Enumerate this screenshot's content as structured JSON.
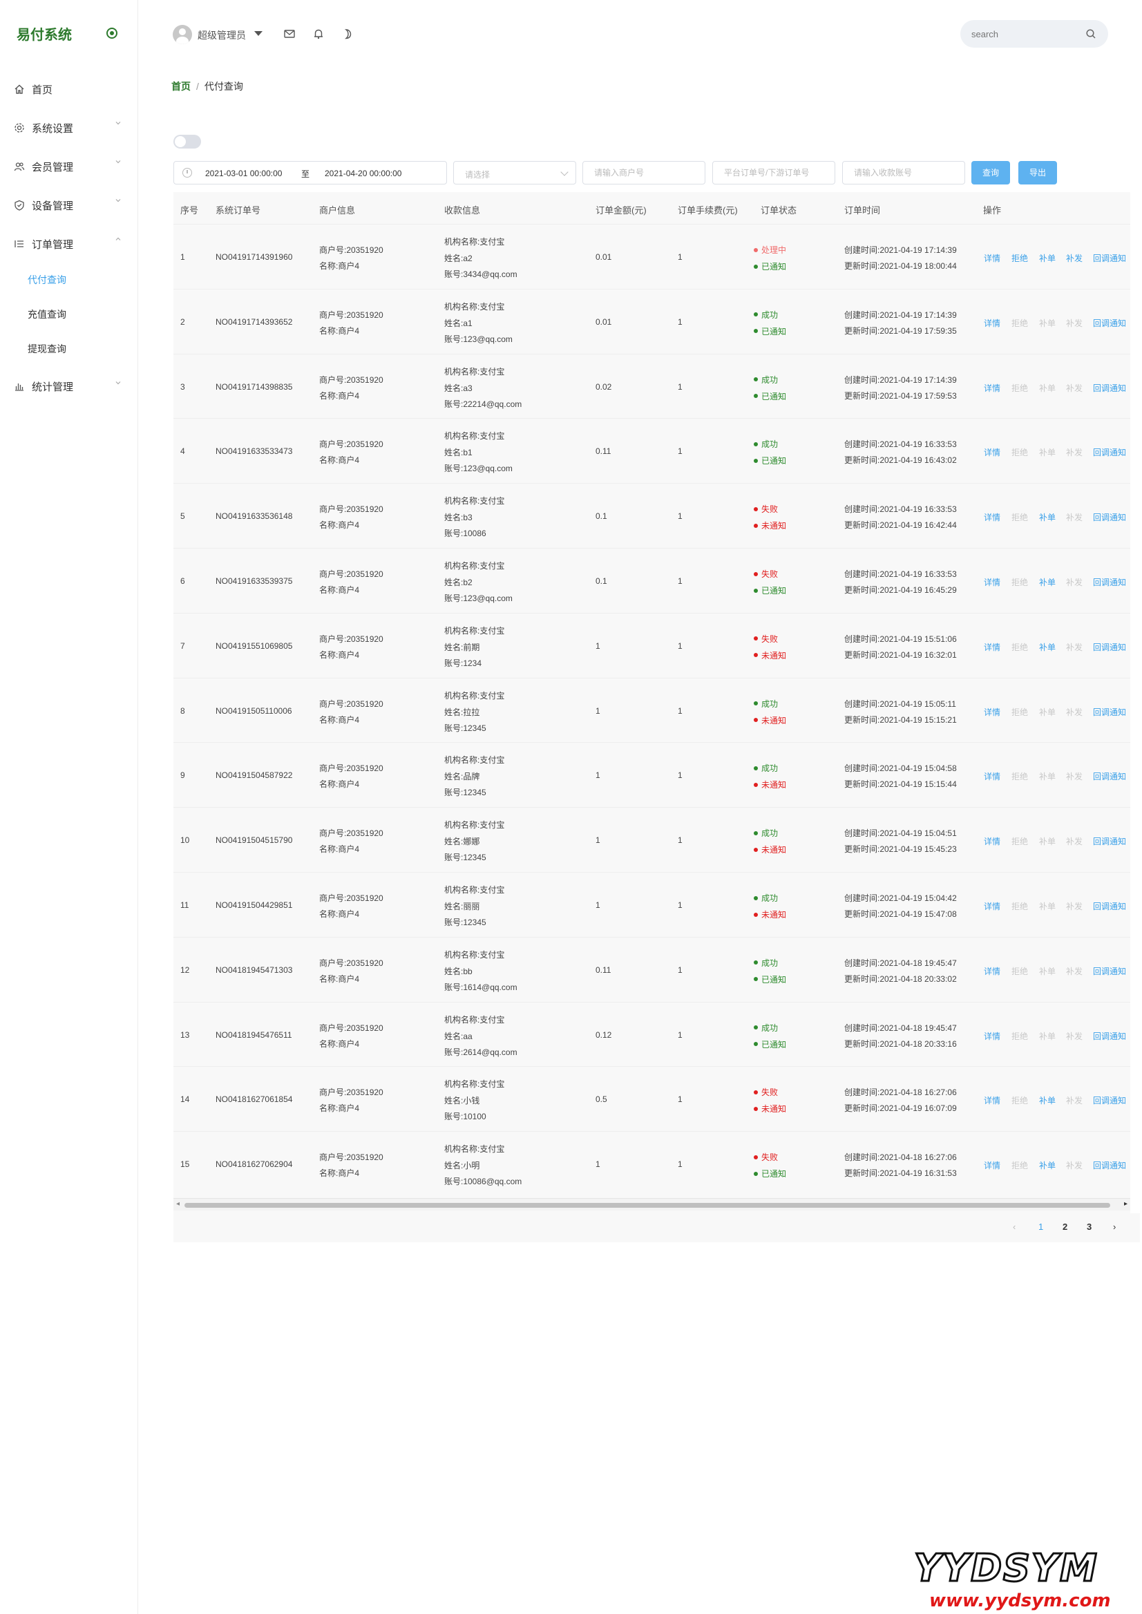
{
  "app": {
    "title": "易付系统"
  },
  "sidebar": {
    "items": [
      {
        "label": "首页",
        "icon": "home-icon"
      },
      {
        "label": "系统设置",
        "icon": "gear-icon"
      },
      {
        "label": "会员管理",
        "icon": "users-icon"
      },
      {
        "label": "设备管理",
        "icon": "shield-icon"
      },
      {
        "label": "订单管理",
        "icon": "list-icon"
      },
      {
        "label": "统计管理",
        "icon": "bar-chart-icon"
      }
    ],
    "sub_items": [
      {
        "label": "代付查询",
        "active": true
      },
      {
        "label": "充值查询",
        "active": false
      },
      {
        "label": "提现查询",
        "active": false
      }
    ]
  },
  "header": {
    "username": "超级管理员",
    "search_placeholder": "search"
  },
  "breadcrumb": {
    "home": "首页",
    "separator": "/",
    "current": "代付查询"
  },
  "filters": {
    "date_start": "2021-03-01 00:00:00",
    "date_sep": "至",
    "date_end": "2021-04-20 00:00:00",
    "select_placeholder": "请选择",
    "merchant_placeholder": "请输入商户号",
    "order_placeholder": "平台订单号/下游订单号",
    "account_placeholder": "请输入收款账号",
    "query_label": "查询",
    "export_label": "导出"
  },
  "table": {
    "headers": [
      "序号",
      "系统订单号",
      "商户信息",
      "收款信息",
      "订单金额(元)",
      "订单手续费(元)",
      "订单状态",
      "订单时间",
      "操作"
    ],
    "actions": [
      "详情",
      "拒绝",
      "补单",
      "补发",
      "回调通知"
    ],
    "rows": [
      {
        "idx": "1",
        "order_no": "NO04191714391960",
        "merchant_no": "商户号:20351920",
        "merchant_name": "名称:商户4",
        "org": "机构名称:支付宝",
        "name": "姓名:a2",
        "account": "账号:3434@qq.com",
        "amount": "0.01",
        "fee": "1",
        "status": "处理中",
        "status_color": "orange",
        "notify": "已通知",
        "notify_color": "green",
        "created": "创建时间:2021-04-19 17:14:39",
        "updated": "更新时间:2021-04-19 18:00:44",
        "enabled": [
          true,
          true,
          true,
          true,
          true
        ]
      },
      {
        "idx": "2",
        "order_no": "NO04191714393652",
        "merchant_no": "商户号:20351920",
        "merchant_name": "名称:商户4",
        "org": "机构名称:支付宝",
        "name": "姓名:a1",
        "account": "账号:123@qq.com",
        "amount": "0.01",
        "fee": "1",
        "status": "成功",
        "status_color": "green",
        "notify": "已通知",
        "notify_color": "green",
        "created": "创建时间:2021-04-19 17:14:39",
        "updated": "更新时间:2021-04-19 17:59:35",
        "enabled": [
          true,
          false,
          false,
          false,
          true
        ]
      },
      {
        "idx": "3",
        "order_no": "NO04191714398835",
        "merchant_no": "商户号:20351920",
        "merchant_name": "名称:商户4",
        "org": "机构名称:支付宝",
        "name": "姓名:a3",
        "account": "账号:22214@qq.com",
        "amount": "0.02",
        "fee": "1",
        "status": "成功",
        "status_color": "green",
        "notify": "已通知",
        "notify_color": "green",
        "created": "创建时间:2021-04-19 17:14:39",
        "updated": "更新时间:2021-04-19 17:59:53",
        "enabled": [
          true,
          false,
          false,
          false,
          true
        ]
      },
      {
        "idx": "4",
        "order_no": "NO04191633533473",
        "merchant_no": "商户号:20351920",
        "merchant_name": "名称:商户4",
        "org": "机构名称:支付宝",
        "name": "姓名:b1",
        "account": "账号:123@qq.com",
        "amount": "0.11",
        "fee": "1",
        "status": "成功",
        "status_color": "green",
        "notify": "已通知",
        "notify_color": "green",
        "created": "创建时间:2021-04-19 16:33:53",
        "updated": "更新时间:2021-04-19 16:43:02",
        "enabled": [
          true,
          false,
          false,
          false,
          true
        ]
      },
      {
        "idx": "5",
        "order_no": "NO04191633536148",
        "merchant_no": "商户号:20351920",
        "merchant_name": "名称:商户4",
        "org": "机构名称:支付宝",
        "name": "姓名:b3",
        "account": "账号:10086",
        "amount": "0.1",
        "fee": "1",
        "status": "失败",
        "status_color": "red",
        "notify": "未通知",
        "notify_color": "red",
        "created": "创建时间:2021-04-19 16:33:53",
        "updated": "更新时间:2021-04-19 16:42:44",
        "enabled": [
          true,
          false,
          true,
          false,
          true
        ]
      },
      {
        "idx": "6",
        "order_no": "NO04191633539375",
        "merchant_no": "商户号:20351920",
        "merchant_name": "名称:商户4",
        "org": "机构名称:支付宝",
        "name": "姓名:b2",
        "account": "账号:123@qq.com",
        "amount": "0.1",
        "fee": "1",
        "status": "失败",
        "status_color": "red",
        "notify": "已通知",
        "notify_color": "green",
        "created": "创建时间:2021-04-19 16:33:53",
        "updated": "更新时间:2021-04-19 16:45:29",
        "enabled": [
          true,
          false,
          true,
          false,
          true
        ]
      },
      {
        "idx": "7",
        "order_no": "NO04191551069805",
        "merchant_no": "商户号:20351920",
        "merchant_name": "名称:商户4",
        "org": "机构名称:支付宝",
        "name": "姓名:前期",
        "account": "账号:1234",
        "amount": "1",
        "fee": "1",
        "status": "失败",
        "status_color": "red",
        "notify": "未通知",
        "notify_color": "red",
        "created": "创建时间:2021-04-19 15:51:06",
        "updated": "更新时间:2021-04-19 16:32:01",
        "enabled": [
          true,
          false,
          true,
          false,
          true
        ]
      },
      {
        "idx": "8",
        "order_no": "NO04191505110006",
        "merchant_no": "商户号:20351920",
        "merchant_name": "名称:商户4",
        "org": "机构名称:支付宝",
        "name": "姓名:拉拉",
        "account": "账号:12345",
        "amount": "1",
        "fee": "1",
        "status": "成功",
        "status_color": "green",
        "notify": "未通知",
        "notify_color": "red",
        "created": "创建时间:2021-04-19 15:05:11",
        "updated": "更新时间:2021-04-19 15:15:21",
        "enabled": [
          true,
          false,
          false,
          false,
          true
        ]
      },
      {
        "idx": "9",
        "order_no": "NO04191504587922",
        "merchant_no": "商户号:20351920",
        "merchant_name": "名称:商户4",
        "org": "机构名称:支付宝",
        "name": "姓名:品牌",
        "account": "账号:12345",
        "amount": "1",
        "fee": "1",
        "status": "成功",
        "status_color": "green",
        "notify": "未通知",
        "notify_color": "red",
        "created": "创建时间:2021-04-19 15:04:58",
        "updated": "更新时间:2021-04-19 15:15:44",
        "enabled": [
          true,
          false,
          false,
          false,
          true
        ]
      },
      {
        "idx": "10",
        "order_no": "NO04191504515790",
        "merchant_no": "商户号:20351920",
        "merchant_name": "名称:商户4",
        "org": "机构名称:支付宝",
        "name": "姓名:娜娜",
        "account": "账号:12345",
        "amount": "1",
        "fee": "1",
        "status": "成功",
        "status_color": "green",
        "notify": "未通知",
        "notify_color": "red",
        "created": "创建时间:2021-04-19 15:04:51",
        "updated": "更新时间:2021-04-19 15:45:23",
        "enabled": [
          true,
          false,
          false,
          false,
          true
        ]
      },
      {
        "idx": "11",
        "order_no": "NO04191504429851",
        "merchant_no": "商户号:20351920",
        "merchant_name": "名称:商户4",
        "org": "机构名称:支付宝",
        "name": "姓名:丽丽",
        "account": "账号:12345",
        "amount": "1",
        "fee": "1",
        "status": "成功",
        "status_color": "green",
        "notify": "未通知",
        "notify_color": "red",
        "created": "创建时间:2021-04-19 15:04:42",
        "updated": "更新时间:2021-04-19 15:47:08",
        "enabled": [
          true,
          false,
          false,
          false,
          true
        ]
      },
      {
        "idx": "12",
        "order_no": "NO04181945471303",
        "merchant_no": "商户号:20351920",
        "merchant_name": "名称:商户4",
        "org": "机构名称:支付宝",
        "name": "姓名:bb",
        "account": "账号:1614@qq.com",
        "amount": "0.11",
        "fee": "1",
        "status": "成功",
        "status_color": "green",
        "notify": "已通知",
        "notify_color": "green",
        "created": "创建时间:2021-04-18 19:45:47",
        "updated": "更新时间:2021-04-18 20:33:02",
        "enabled": [
          true,
          false,
          false,
          false,
          true
        ]
      },
      {
        "idx": "13",
        "order_no": "NO04181945476511",
        "merchant_no": "商户号:20351920",
        "merchant_name": "名称:商户4",
        "org": "机构名称:支付宝",
        "name": "姓名:aa",
        "account": "账号:2614@qq.com",
        "amount": "0.12",
        "fee": "1",
        "status": "成功",
        "status_color": "green",
        "notify": "已通知",
        "notify_color": "green",
        "created": "创建时间:2021-04-18 19:45:47",
        "updated": "更新时间:2021-04-18 20:33:16",
        "enabled": [
          true,
          false,
          false,
          false,
          true
        ]
      },
      {
        "idx": "14",
        "order_no": "NO04181627061854",
        "merchant_no": "商户号:20351920",
        "merchant_name": "名称:商户4",
        "org": "机构名称:支付宝",
        "name": "姓名:小钱",
        "account": "账号:10100",
        "amount": "0.5",
        "fee": "1",
        "status": "失败",
        "status_color": "red",
        "notify": "未通知",
        "notify_color": "red",
        "created": "创建时间:2021-04-18 16:27:06",
        "updated": "更新时间:2021-04-19 16:07:09",
        "enabled": [
          true,
          false,
          true,
          false,
          true
        ]
      },
      {
        "idx": "15",
        "order_no": "NO04181627062904",
        "merchant_no": "商户号:20351920",
        "merchant_name": "名称:商户4",
        "org": "机构名称:支付宝",
        "name": "姓名:小明",
        "account": "账号:10086@qq.com",
        "amount": "1",
        "fee": "1",
        "status": "失败",
        "status_color": "red",
        "notify": "已通知",
        "notify_color": "green",
        "created": "创建时间:2021-04-18 16:27:06",
        "updated": "更新时间:2021-04-19 16:31:53",
        "enabled": [
          true,
          false,
          true,
          false,
          true
        ]
      }
    ]
  },
  "pagination": {
    "prev": "‹",
    "pages": [
      "1",
      "2",
      "3"
    ],
    "current": "1",
    "next": "›"
  },
  "watermark": {
    "brand": "YYDSYM",
    "url": "www.yydsym.com"
  },
  "colors": {
    "accent": "#3aa0e8",
    "brand": "#2d7a2d",
    "success": "#2e8b2e",
    "danger": "#e02020",
    "pending": "#f06a6a"
  }
}
